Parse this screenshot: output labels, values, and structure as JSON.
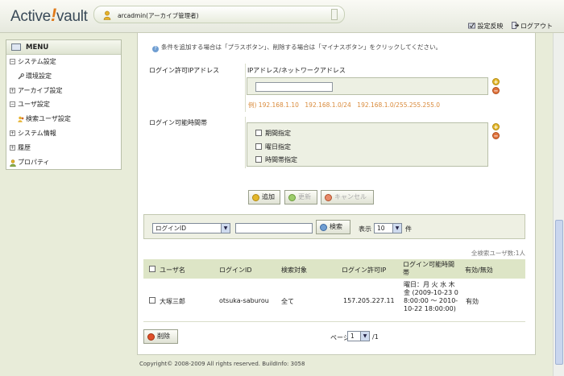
{
  "header": {
    "logo": "Active!vault",
    "logo_prefix": "Active",
    "logo_bang": "!",
    "logo_suffix": "vault",
    "user": "arcadmin(アーカイブ管理者)",
    "links": [
      "設定反映",
      "ログアウト"
    ]
  },
  "menu": {
    "title": "MENU",
    "items": [
      {
        "label": "システム設定",
        "expander": "−"
      },
      {
        "label": "環境設定",
        "sub": true
      },
      {
        "label": "アーカイブ設定",
        "expander": "+"
      },
      {
        "label": "ユーザ設定",
        "expander": "−"
      },
      {
        "label": "検索ユーザ設定",
        "sub": true
      },
      {
        "label": "システム情報",
        "expander": "+"
      },
      {
        "label": "履歴",
        "expander": "+"
      },
      {
        "label": "プロパティ",
        "icon": "user-icon"
      }
    ]
  },
  "form": {
    "note": "条件を追加する場合は「プラスボタン」、削除する場合は「マイナスボタン」をクリックしてください。",
    "ip_label": "ログイン許可IPアドレス",
    "ip_column": "IPアドレス/ネットワークアドレス",
    "ip_value": "",
    "ip_example": "例) 192.168.1.10　192.168.1.0/24　192.168.1.0/255.255.255.0",
    "time_label": "ログイン可能時間帯",
    "time_options": [
      "期間指定",
      "曜日指定",
      "時間帯指定"
    ],
    "plus": "+",
    "minus": "−",
    "buttons": {
      "add": "追加",
      "update": "更新",
      "cancel": "キャンセル"
    }
  },
  "search": {
    "field": "ログインID",
    "query": "",
    "button": "検索",
    "display_label": "表示",
    "page_size": "10",
    "unit": "件"
  },
  "results": {
    "count_text": "全検索ユーザ数:1人",
    "columns": [
      "ユーザ名",
      "ログインID",
      "検索対象",
      "ログイン許可IP",
      "ログイン可能時間帯",
      "有効/無効"
    ],
    "rows": [
      {
        "name": "大塚三郎",
        "login_id": "otsuka-saburou",
        "target": "全て",
        "ip": "157.205.227.11",
        "time": "曜日：月 火 水 木 金 (2009-10-23 08:00:00 〜 2010-10-22 18:00:00)",
        "status": "有効"
      }
    ],
    "delete_button": "削除",
    "page_label": "ページ",
    "page": "1",
    "page_total": "/1"
  },
  "footer": {
    "copyright": "Copyright© 2008-2009 All rights reserved.  BuildInfo: 3058"
  },
  "colors": {
    "accent": "#e07a1a",
    "example_text": "#d98a3a",
    "table_header": "#dde5c6"
  }
}
